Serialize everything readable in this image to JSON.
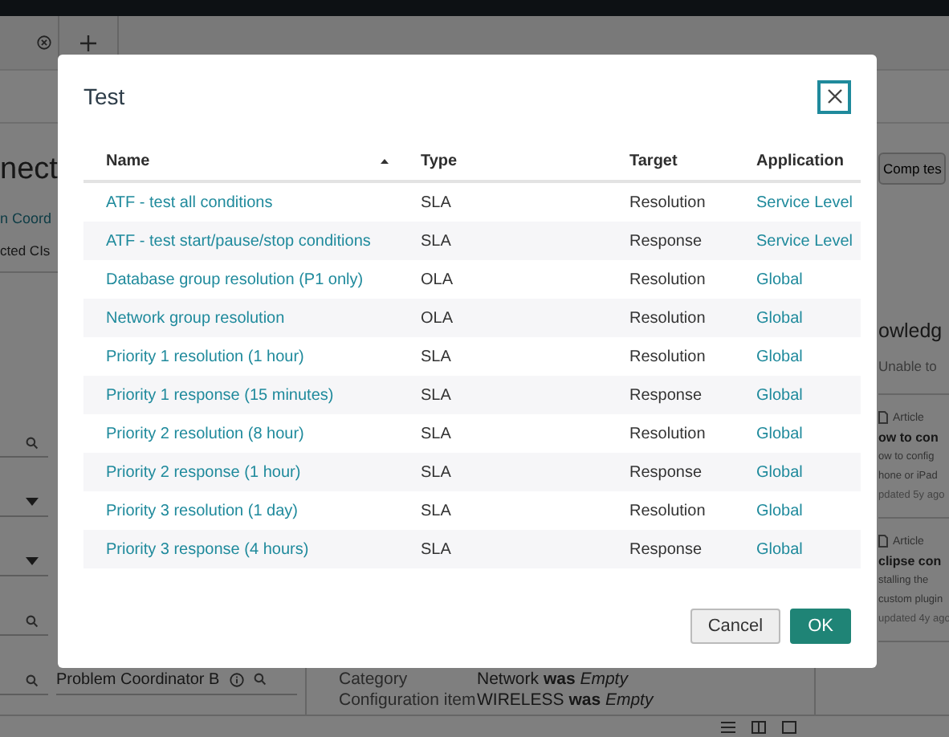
{
  "background": {
    "heading": "nect",
    "link": "n Coord",
    "tab": "cted CIs",
    "fields": [
      {
        "kind": "lookup"
      },
      {
        "kind": "choice"
      },
      {
        "kind": "choice"
      },
      {
        "kind": "lookup"
      },
      {
        "kind": "lookup",
        "neighbor": "Problem Coordinator B"
      }
    ],
    "activity": [
      {
        "label": "Category",
        "value": "Network **was** *Empty*"
      },
      {
        "label": "Configuration item",
        "value": "WIRELESS **was** *Empty*"
      }
    ],
    "side_button": "Comp tes",
    "side_heading": "owledg",
    "side_note": "Unable to",
    "articles": [
      {
        "type": "Article",
        "title": "ow to con",
        "lines": [
          "ow to config",
          "hone or iPad"
        ],
        "updated": "pdated 5y ago"
      },
      {
        "type": "Article",
        "title": "clipse con",
        "lines": [
          "stalling the",
          "custom plugin"
        ],
        "updated": "updated 4y ago"
      }
    ]
  },
  "dialog": {
    "title": "Test",
    "columns": [
      {
        "label": "Name",
        "sorted": true
      },
      {
        "label": "Type"
      },
      {
        "label": "Target"
      },
      {
        "label": "Application"
      }
    ],
    "rows": [
      {
        "name": "ATF - test all conditions",
        "type": "SLA",
        "target": "Resolution",
        "application": "Service Level"
      },
      {
        "name": "ATF - test start/pause/stop conditions",
        "type": "SLA",
        "target": "Response",
        "application": "Service Level"
      },
      {
        "name": "Database group resolution (P1 only)",
        "type": "OLA",
        "target": "Resolution",
        "application": "Global"
      },
      {
        "name": "Network group resolution",
        "type": "OLA",
        "target": "Resolution",
        "application": "Global"
      },
      {
        "name": "Priority 1 resolution (1 hour)",
        "type": "SLA",
        "target": "Resolution",
        "application": "Global"
      },
      {
        "name": "Priority 1 response (15 minutes)",
        "type": "SLA",
        "target": "Response",
        "application": "Global"
      },
      {
        "name": "Priority 2 resolution (8 hour)",
        "type": "SLA",
        "target": "Resolution",
        "application": "Global"
      },
      {
        "name": "Priority 2 response (1 hour)",
        "type": "SLA",
        "target": "Response",
        "application": "Global"
      },
      {
        "name": "Priority 3 resolution (1 day)",
        "type": "SLA",
        "target": "Resolution",
        "application": "Global"
      },
      {
        "name": "Priority 3 response (4 hours)",
        "type": "SLA",
        "target": "Response",
        "application": "Global"
      }
    ],
    "buttons": [
      {
        "label": "Cancel",
        "kind": "secondary"
      },
      {
        "label": "OK",
        "kind": "primary"
      }
    ]
  }
}
